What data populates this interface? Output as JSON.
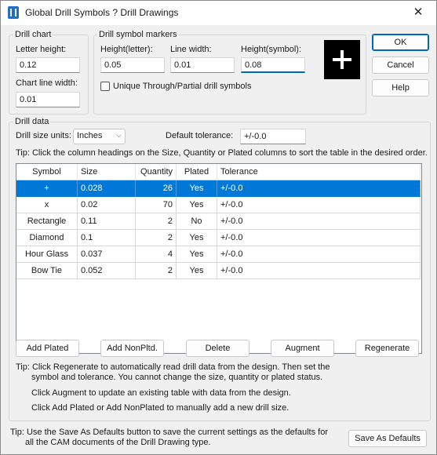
{
  "window": {
    "title": "Global Drill Symbols ? Drill Drawings",
    "close_glyph": "✕"
  },
  "drill_chart": {
    "group_label": "Drill chart",
    "letter_height_label": "Letter height:",
    "letter_height_value": "0.12",
    "chart_line_width_label": "Chart line width:",
    "chart_line_width_value": "0.01"
  },
  "symbol_markers": {
    "group_label": "Drill symbol markers",
    "height_letter_label": "Height(letter):",
    "height_letter_value": "0.05",
    "line_width_label": "Line width:",
    "line_width_value": "0.01",
    "height_symbol_label": "Height(symbol):",
    "height_symbol_value": "0.08",
    "unique_label": "Unique Through/Partial drill symbols",
    "unique_checked": false,
    "preview_symbol": "plus-symbol"
  },
  "buttons": {
    "ok": "OK",
    "cancel": "Cancel",
    "help": "Help"
  },
  "drill_data": {
    "group_label": "Drill data",
    "units_label": "Drill size units:",
    "units_value": "Inches",
    "tolerance_label": "Default tolerance:",
    "tolerance_value": "+/-0.0",
    "tip_sort": "Tip: Click the column headings on the Size, Quantity or Plated columns to sort the table in the desired order.",
    "columns": [
      "Symbol",
      "Size",
      "Quantity",
      "Plated",
      "Tolerance"
    ],
    "rows": [
      {
        "symbol": "+",
        "size": "0.028",
        "quantity": "26",
        "plated": "Yes",
        "tolerance": "+/-0.0",
        "selected": true
      },
      {
        "symbol": "x",
        "size": "0.02",
        "quantity": "70",
        "plated": "Yes",
        "tolerance": "+/-0.0",
        "selected": false
      },
      {
        "symbol": "Rectangle",
        "size": "0.11",
        "quantity": "2",
        "plated": "No",
        "tolerance": "+/-0.0",
        "selected": false
      },
      {
        "symbol": "Diamond",
        "size": "0.1",
        "quantity": "2",
        "plated": "Yes",
        "tolerance": "+/-0.0",
        "selected": false
      },
      {
        "symbol": "Hour Glass",
        "size": "0.037",
        "quantity": "4",
        "plated": "Yes",
        "tolerance": "+/-0.0",
        "selected": false
      },
      {
        "symbol": "Bow Tie",
        "size": "0.052",
        "quantity": "2",
        "plated": "Yes",
        "tolerance": "+/-0.0",
        "selected": false
      }
    ],
    "actions": {
      "add_plated": "Add Plated",
      "add_nonplated": "Add NonPltd.",
      "delete": "Delete",
      "augment": "Augment",
      "regenerate": "Regenerate"
    },
    "tip_regen_1": "Tip: Click Regenerate to automatically read drill data from the design. Then set the",
    "tip_regen_2": "symbol and tolerance. You cannot change the size, quantity or plated status.",
    "tip_augment": "Click Augment to update an existing table with data from the design.",
    "tip_add": "Click Add Plated or Add NonPlated to manually add a new drill size."
  },
  "footer": {
    "tip_1": "Tip: Use the Save As Defaults button to save the current settings as the defaults for",
    "tip_2": "all the CAM documents of the Drill Drawing type.",
    "save_defaults": "Save As Defaults"
  }
}
